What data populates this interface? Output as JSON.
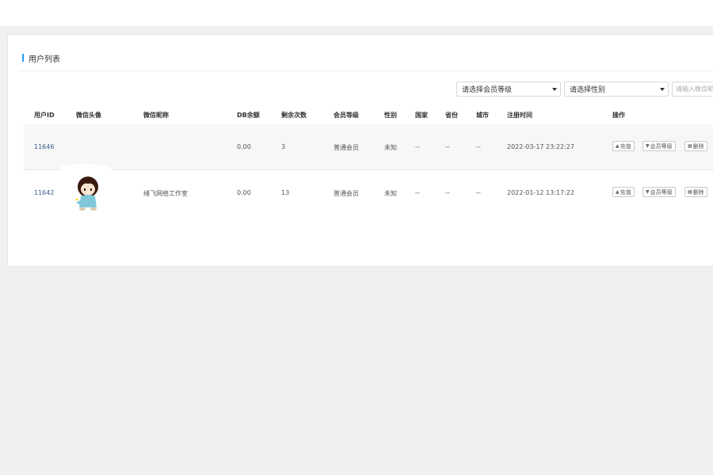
{
  "card": {
    "title": "用户列表"
  },
  "filters": {
    "level_select": "请选择会员等级",
    "gender_select": "请选择性别",
    "search_placeholder": "请输入微信昵称"
  },
  "table": {
    "headers": {
      "user_id": "用户ID",
      "avatar": "微信头像",
      "nickname": "微信昵称",
      "balance": "DB余额",
      "remaining": "剩余次数",
      "level": "会员等级",
      "gender": "性别",
      "country": "国家",
      "province": "省份",
      "city": "城市",
      "register_time": "注册时间",
      "actions": "操作"
    },
    "rows": [
      {
        "user_id": "11646",
        "nickname": "",
        "balance": "0.00",
        "remaining": "3",
        "level": "普通会员",
        "gender": "未知",
        "country": "--",
        "province": "--",
        "city": "--",
        "register_time": "2022-03-17 23:22:27"
      },
      {
        "user_id": "11642",
        "nickname": "绪飞网络工作室",
        "balance": "0.00",
        "remaining": "13",
        "level": "普通会员",
        "gender": "未知",
        "country": "--",
        "province": "--",
        "city": "--",
        "register_time": "2022-01-12 13:17:22"
      }
    ],
    "actions": {
      "recharge": "充值",
      "member_level": "会员等级",
      "delete": "删除"
    }
  },
  "icons": {
    "recharge": "money-bag-icon",
    "member_level": "badge-icon",
    "delete": "trash-icon"
  },
  "colors": {
    "accent": "#1e9fff",
    "id_text": "#3a5a8c"
  }
}
